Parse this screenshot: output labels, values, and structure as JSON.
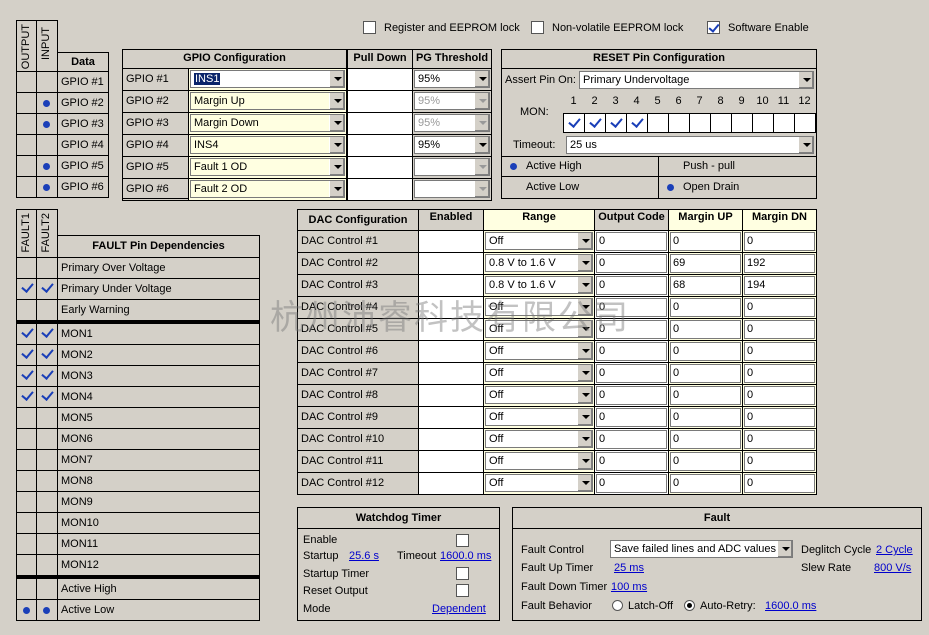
{
  "top_options": [
    {
      "label": "Register and EEPROM lock",
      "checked": false
    },
    {
      "label": "Non-volatile EEPROM lock",
      "checked": false
    },
    {
      "label": "Software Enable",
      "checked": true
    }
  ],
  "io": {
    "output_label": "OUTPUT",
    "input_label": "INPUT",
    "data_label": "Data",
    "rows": [
      {
        "name": "GPIO #1",
        "output": false,
        "input": false
      },
      {
        "name": "GPIO #2",
        "output": false,
        "input": true
      },
      {
        "name": "GPIO #3",
        "output": false,
        "input": true
      },
      {
        "name": "GPIO #4",
        "output": false,
        "input": false
      },
      {
        "name": "GPIO #5",
        "output": false,
        "input": true
      },
      {
        "name": "GPIO #6",
        "output": false,
        "input": true
      }
    ]
  },
  "gpio": {
    "title": "GPIO Configuration",
    "pulldown_title": "Pull Down",
    "pg_title": "PG Threshold",
    "rows": [
      {
        "name": "GPIO #1",
        "config": "INS1",
        "pg": "95%",
        "pg_enabled": true
      },
      {
        "name": "GPIO #2",
        "config": "Margin Up",
        "pg": "95%",
        "pg_enabled": false
      },
      {
        "name": "GPIO #3",
        "config": "Margin Down",
        "pg": "95%",
        "pg_enabled": false
      },
      {
        "name": "GPIO #4",
        "config": "INS4",
        "pg": "95%",
        "pg_enabled": true
      },
      {
        "name": "GPIO #5",
        "config": "Fault 1 OD",
        "pg": "",
        "pg_enabled": false
      },
      {
        "name": "GPIO #6",
        "config": "Fault 2 OD",
        "pg": "",
        "pg_enabled": false
      }
    ]
  },
  "reset": {
    "title": "RESET Pin Configuration",
    "assert_label": "Assert Pin On:",
    "assert_value": "Primary Undervoltage",
    "mon_label": "MON:",
    "mon_numbers": [
      "1",
      "2",
      "3",
      "4",
      "5",
      "6",
      "7",
      "8",
      "9",
      "10",
      "11",
      "12"
    ],
    "mon_checked": [
      true,
      true,
      true,
      true,
      false,
      false,
      false,
      false,
      false,
      false,
      false,
      false
    ],
    "timeout_label": "Timeout:",
    "timeout_value": "25 us",
    "active_high": "Active High",
    "active_low": "Active Low",
    "push_pull": "Push - pull",
    "open_drain": "Open Drain"
  },
  "fault_pins": {
    "fault1_label": "FAULT1",
    "fault2_label": "FAULT2",
    "title": "FAULT Pin Dependencies",
    "rows": [
      {
        "name": "Primary Over Voltage",
        "f1": false,
        "f2": false
      },
      {
        "name": "Primary Under Voltage",
        "f1": true,
        "f2": true
      },
      {
        "name": "Early Warning",
        "f1": false,
        "f2": false
      }
    ],
    "mons": [
      {
        "name": "MON1",
        "f1": true,
        "f2": true
      },
      {
        "name": "MON2",
        "f1": true,
        "f2": true
      },
      {
        "name": "MON3",
        "f1": true,
        "f2": true
      },
      {
        "name": "MON4",
        "f1": true,
        "f2": true
      },
      {
        "name": "MON5",
        "f1": false,
        "f2": false
      },
      {
        "name": "MON6",
        "f1": false,
        "f2": false
      },
      {
        "name": "MON7",
        "f1": false,
        "f2": false
      },
      {
        "name": "MON8",
        "f1": false,
        "f2": false
      },
      {
        "name": "MON9",
        "f1": false,
        "f2": false
      },
      {
        "name": "MON10",
        "f1": false,
        "f2": false
      },
      {
        "name": "MON11",
        "f1": false,
        "f2": false
      },
      {
        "name": "MON12",
        "f1": false,
        "f2": false
      }
    ],
    "active_high": "Active High",
    "active_low": "Active Low"
  },
  "dac": {
    "title": "DAC Configuration",
    "enabled_title": "Enabled",
    "range_title": "Range",
    "code_title": "Output Code",
    "up_title": "Margin UP",
    "dn_title": "Margin DN",
    "rows": [
      {
        "name": "DAC Control #1",
        "range": "Off",
        "code": "0",
        "up": "0",
        "dn": "0"
      },
      {
        "name": "DAC Control #2",
        "range": "0.8 V to 1.6 V",
        "code": "0",
        "up": "69",
        "dn": "192"
      },
      {
        "name": "DAC Control #3",
        "range": "0.8 V to 1.6 V",
        "code": "0",
        "up": "68",
        "dn": "194"
      },
      {
        "name": "DAC Control #4",
        "range": "Off",
        "code": "0",
        "up": "0",
        "dn": "0"
      },
      {
        "name": "DAC Control #5",
        "range": "Off",
        "code": "0",
        "up": "0",
        "dn": "0"
      },
      {
        "name": "DAC Control #6",
        "range": "Off",
        "code": "0",
        "up": "0",
        "dn": "0"
      },
      {
        "name": "DAC Control #7",
        "range": "Off",
        "code": "0",
        "up": "0",
        "dn": "0"
      },
      {
        "name": "DAC Control #8",
        "range": "Off",
        "code": "0",
        "up": "0",
        "dn": "0"
      },
      {
        "name": "DAC Control #9",
        "range": "Off",
        "code": "0",
        "up": "0",
        "dn": "0"
      },
      {
        "name": "DAC Control #10",
        "range": "Off",
        "code": "0",
        "up": "0",
        "dn": "0"
      },
      {
        "name": "DAC Control #11",
        "range": "Off",
        "code": "0",
        "up": "0",
        "dn": "0"
      },
      {
        "name": "DAC Control #12",
        "range": "Off",
        "code": "0",
        "up": "0",
        "dn": "0"
      }
    ]
  },
  "watchdog": {
    "title": "Watchdog Timer",
    "enable_label": "Enable",
    "startup_label": "Startup",
    "startup_value": "25.6 s",
    "timeout_label": "Timeout",
    "timeout_value": "1600.0 ms",
    "startup_timer_label": "Startup Timer",
    "reset_output_label": "Reset Output",
    "mode_label": "Mode",
    "mode_value": "Dependent"
  },
  "fault": {
    "title": "Fault",
    "control_label": "Fault Control",
    "control_value": "Save failed lines and ADC values",
    "deglitch_label": "Deglitch Cycle",
    "deglitch_value": "2 Cycle",
    "up_timer_label": "Fault Up Timer",
    "up_timer_value": "25 ms",
    "slew_label": "Slew Rate",
    "slew_value": "800 V/s",
    "down_timer_label": "Fault Down Timer",
    "down_timer_value": "100 ms",
    "behavior_label": "Fault Behavior",
    "latch_off": "Latch-Off",
    "auto_retry": "Auto-Retry:",
    "auto_retry_value": "1600.0 ms"
  },
  "watermark": "杭州沛睿科技有限公司"
}
